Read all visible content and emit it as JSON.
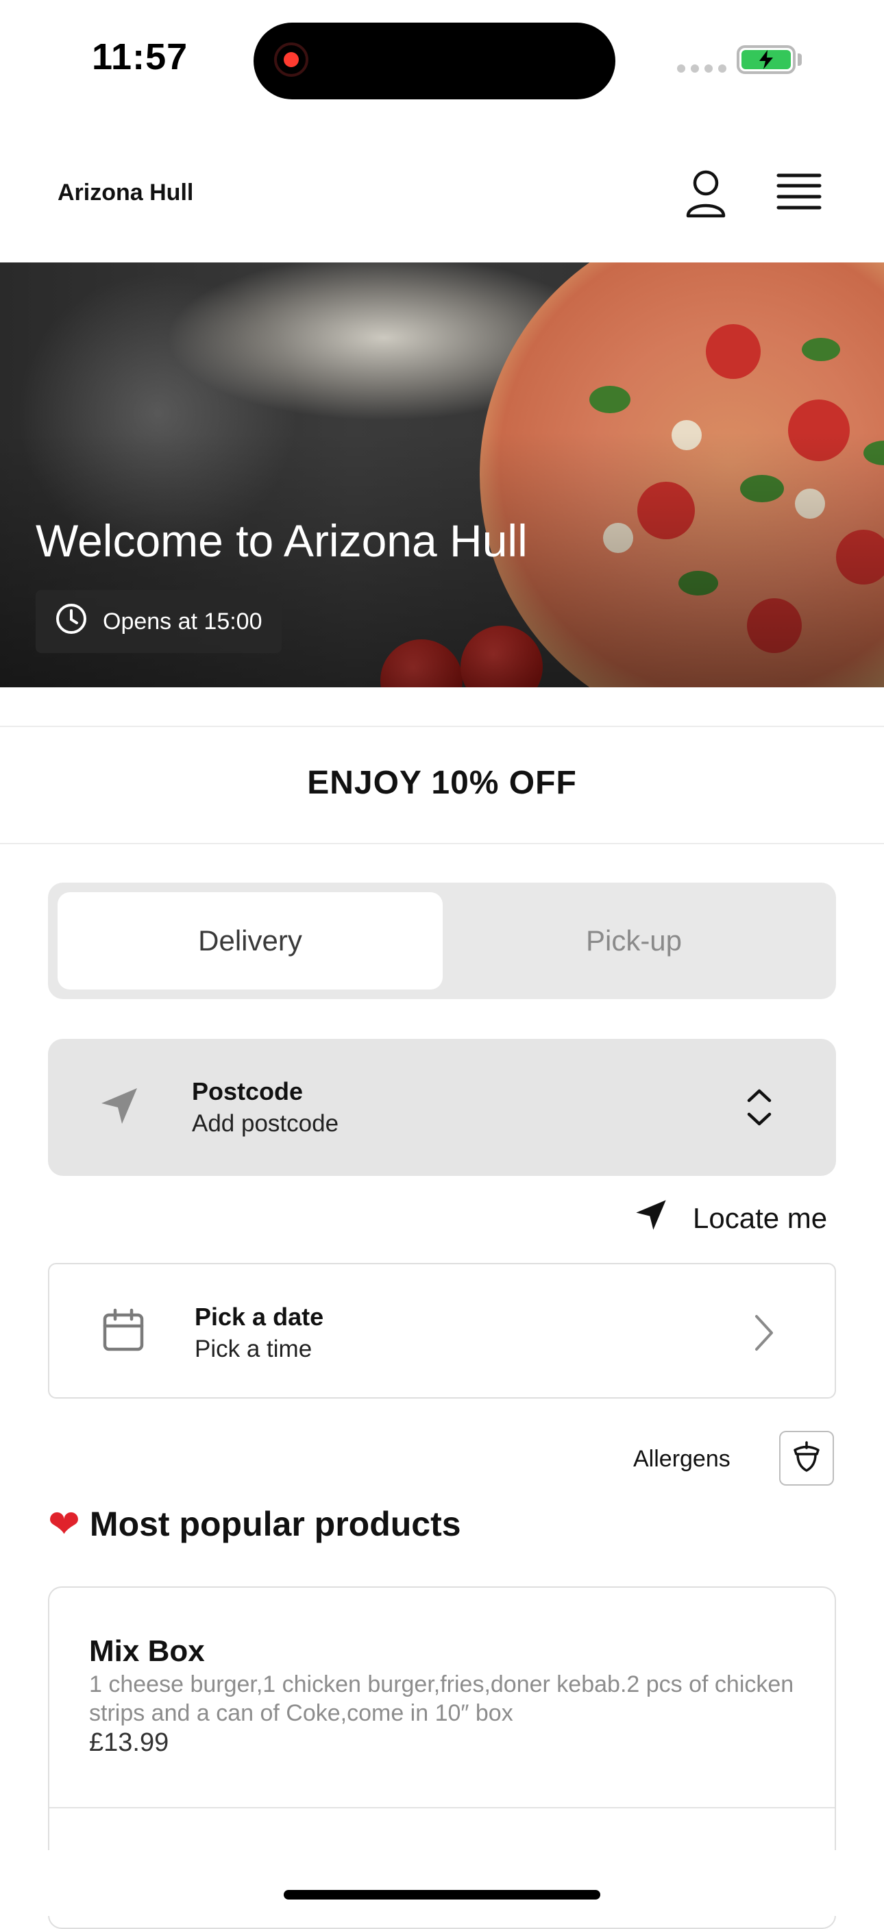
{
  "status_bar": {
    "time": "11:57"
  },
  "header": {
    "brand": "Arizona Hull"
  },
  "hero": {
    "title": "Welcome to Arizona Hull",
    "opens_text": "Opens at 15:00"
  },
  "promo": {
    "text": "ENJOY 10% OFF"
  },
  "order_mode": {
    "tabs": [
      {
        "label": "Delivery",
        "active": true
      },
      {
        "label": "Pick-up",
        "active": false
      }
    ]
  },
  "postcode": {
    "title": "Postcode",
    "placeholder": "Add postcode"
  },
  "locate": {
    "label": "Locate me"
  },
  "schedule": {
    "date_label": "Pick a date",
    "time_label": "Pick a time"
  },
  "allergens": {
    "label": "Allergens"
  },
  "popular": {
    "heading": "Most popular products",
    "products": [
      {
        "name": "Mix Box",
        "description": "1 cheese burger,1 chicken burger,fries,doner kebab.2 pcs of chicken strips and a can of Coke,come in 10″ box",
        "price": "£13.99"
      }
    ]
  },
  "icons": {
    "account": "user-icon",
    "menu": "hamburger-menu-icon",
    "clock": "clock-icon",
    "location": "location-arrow-icon",
    "sort": "up-down-chevron-icon",
    "calendar": "calendar-icon",
    "chevron": "chevron-right-icon",
    "allergen": "acorn-icon",
    "heart": "heart-icon"
  },
  "colors": {
    "battery": "#34c759",
    "record_dot": "#ff3b30",
    "heart": "#e0222b",
    "tab_track": "#e8e8e8",
    "field_bg": "#e5e5e5"
  }
}
